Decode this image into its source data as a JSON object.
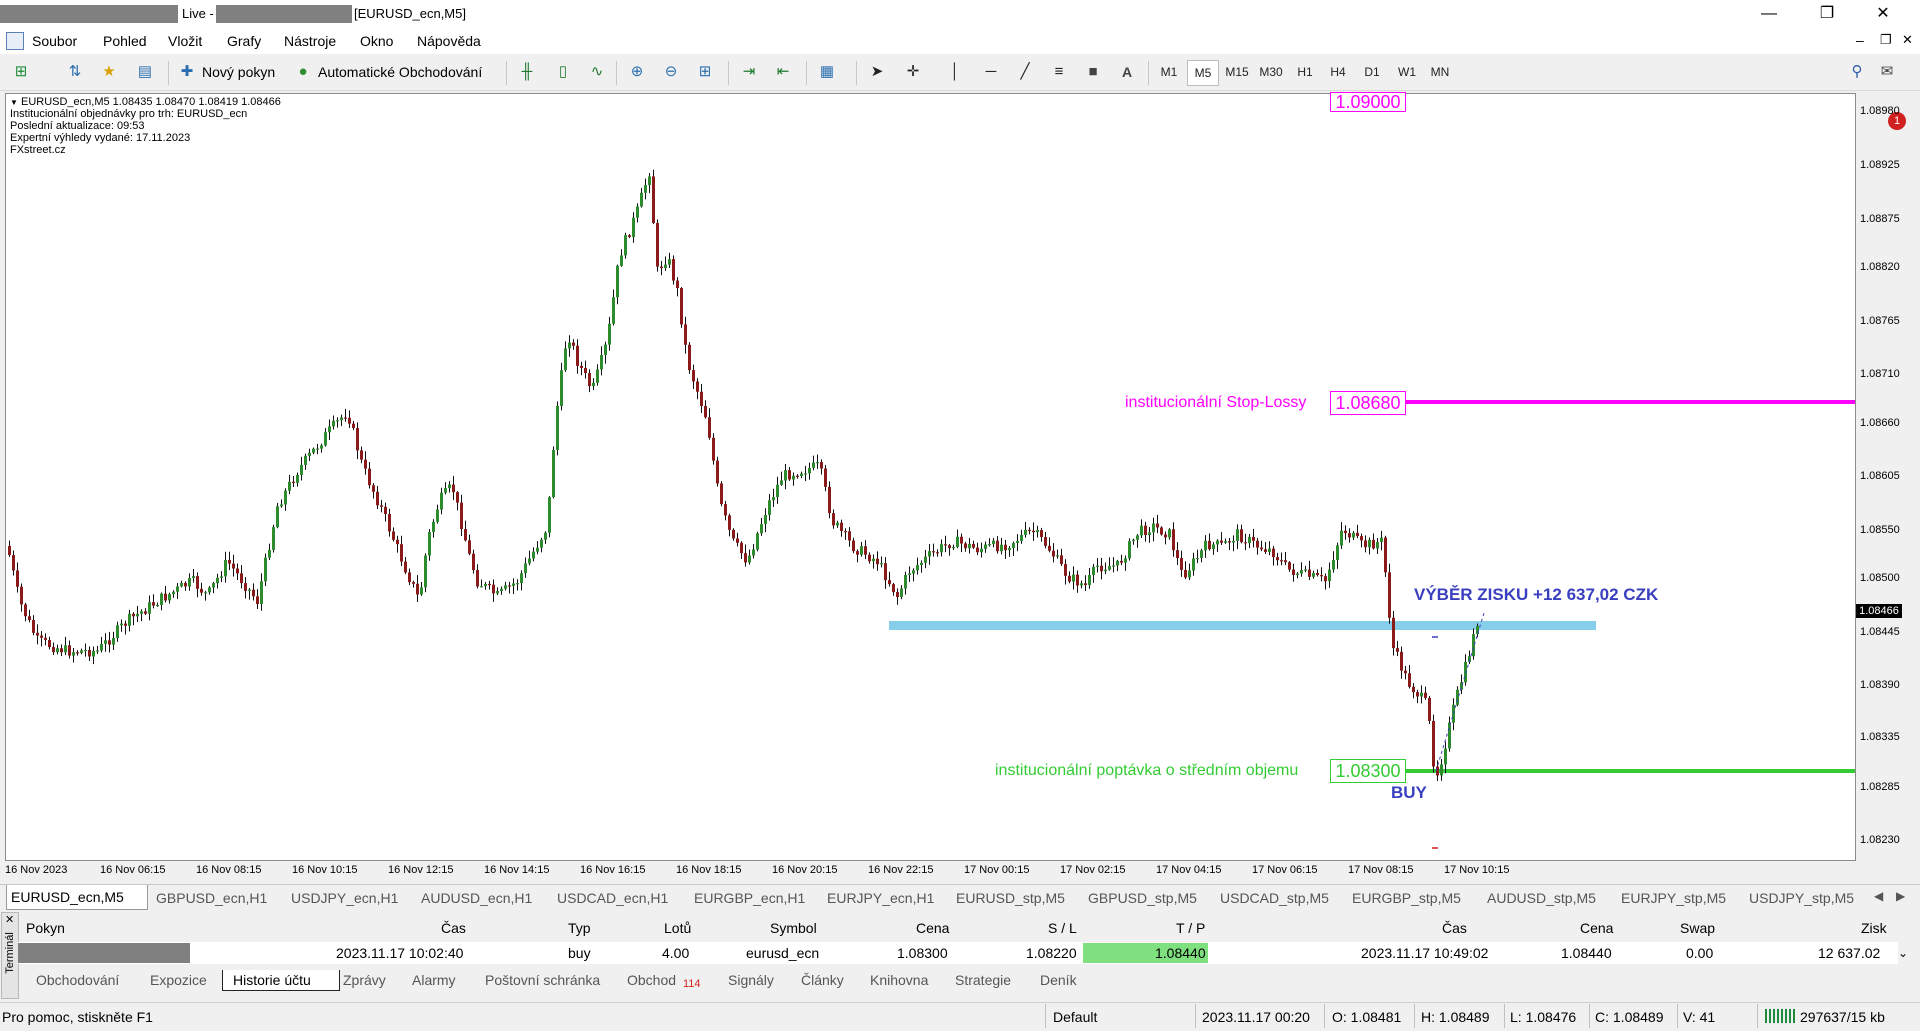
{
  "window": {
    "title_prefix": "Live -",
    "title_suffix": "[EURUSD_ecn,M5]",
    "minimize": "—",
    "restore": "❐",
    "close": "✕"
  },
  "menu": [
    "Soubor",
    "Pohled",
    "Vložit",
    "Grafy",
    "Nástroje",
    "Okno",
    "Nápověda"
  ],
  "toolbar": {
    "new_order": "Nový pokyn",
    "auto_trading": "Automatické Obchodování",
    "timeframes": [
      "M1",
      "M5",
      "M15",
      "M30",
      "H1",
      "H4",
      "D1",
      "W1",
      "MN"
    ],
    "active_timeframe": "M5",
    "text_tool": "A",
    "notification_count": "1"
  },
  "chart": {
    "header_line": "EURUSD_ecn,M5  1.08435 1.08470 1.08419 1.08466",
    "info_lines": [
      "Institucionální objednávky pro trh: EURUSD_ecn",
      "Poslední aktualizace: 09:53",
      "Expertní výhledy vydané: 17.11.2023",
      "FXstreet.cz"
    ],
    "price_ticks": [
      "1.08980",
      "1.08925",
      "1.08875",
      "1.08820",
      "1.08765",
      "1.08710",
      "1.08660",
      "1.08605",
      "1.08550",
      "1.08500",
      "1.08445",
      "1.08390",
      "1.08335",
      "1.08285",
      "1.08230"
    ],
    "current_price": "1.08466",
    "time_ticks": [
      "16 Nov 2023",
      "16 Nov 06:15",
      "16 Nov 08:15",
      "16 Nov 10:15",
      "16 Nov 12:15",
      "16 Nov 14:15",
      "16 Nov 16:15",
      "16 Nov 18:15",
      "16 Nov 20:15",
      "16 Nov 22:15",
      "17 Nov 00:15",
      "17 Nov 02:15",
      "17 Nov 04:15",
      "17 Nov 06:15",
      "17 Nov 08:15",
      "17 Nov 10:15"
    ],
    "levels": {
      "top_label": "1.09000",
      "stop_loss_text": "institucionální Stop-Lossy",
      "stop_loss_price": "1.08680",
      "demand_text": "institucionální poptávka o středním objemu",
      "demand_price": "1.08300"
    },
    "annotations": {
      "profit": "VÝBĚR ZISKU +12 637,02 CZK",
      "buy": "BUY"
    },
    "colors": {
      "stop_loss": "#ff00ff",
      "demand": "#33cc33",
      "zone": "#87ceeb",
      "annotation": "#3a3fbf",
      "bull": "#2e8b2e",
      "bear": "#8b1a1a"
    }
  },
  "symbol_tabs": [
    "EURUSD_ecn,M5",
    "GBPUSD_ecn,H1",
    "USDJPY_ecn,H1",
    "AUDUSD_ecn,H1",
    "USDCAD_ecn,H1",
    "EURGBP_ecn,H1",
    "EURJPY_ecn,H1",
    "EURUSD_stp,M5",
    "GBPUSD_stp,M5",
    "USDCAD_stp,M5",
    "EURGBP_stp,M5",
    "AUDUSD_stp,M5",
    "EURJPY_stp,M5",
    "USDJPY_stp,M5"
  ],
  "terminal": {
    "side_label": "Terminál",
    "headers": [
      "Pokyn",
      "Čas",
      "Typ",
      "Lotů",
      "Symbol",
      "Cena",
      "S / L",
      "T / P",
      "Čas",
      "Cena",
      "Swap",
      "Zisk"
    ],
    "row": {
      "time_open": "2023.11.17 10:02:40",
      "type": "buy",
      "lots": "4.00",
      "symbol": "eurusd_ecn",
      "price_open": "1.08300",
      "sl": "1.08220",
      "tp": "1.08440",
      "time_close": "2023.11.17 10:49:02",
      "price_close": "1.08440",
      "swap": "0.00",
      "profit": "12 637.02"
    },
    "tabs": [
      "Obchodování",
      "Expozice",
      "Historie účtu",
      "Zprávy",
      "Alarmy",
      "Poštovní schránka",
      "Obchod",
      "Signály",
      "Články",
      "Knihovna",
      "Strategie",
      "Deník"
    ],
    "trade_badge": "114",
    "active_tab": "Historie účtu"
  },
  "status": {
    "help": "Pro pomoc, stiskněte F1",
    "profile": "Default",
    "datetime": "2023.11.17 00:20",
    "open": "O: 1.08481",
    "high": "H: 1.08489",
    "low": "L: 1.08476",
    "close": "C: 1.08489",
    "volume": "V: 41",
    "traffic": "297637/15 kb"
  }
}
